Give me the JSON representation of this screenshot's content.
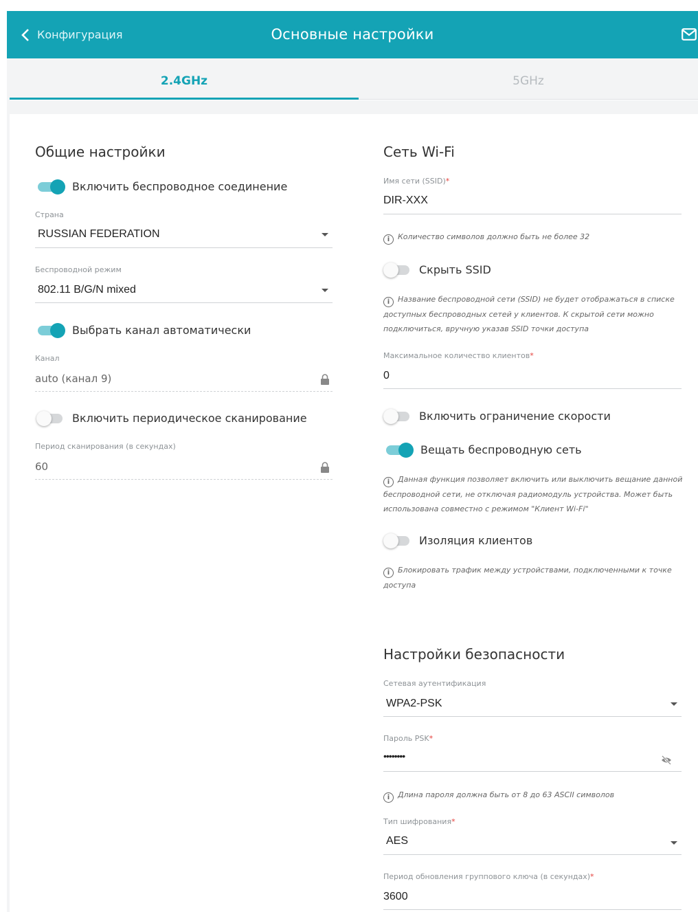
{
  "header": {
    "back_label": "Конфигурация",
    "title": "Основные настройки"
  },
  "tabs": [
    {
      "label": "2.4GHz",
      "active": true
    },
    {
      "label": "5GHz",
      "active": false
    }
  ],
  "general": {
    "title": "Общие настройки",
    "enable_wireless": {
      "label": "Включить беспроводное соединение",
      "on": true
    },
    "country": {
      "label": "Страна",
      "value": "RUSSIAN FEDERATION"
    },
    "mode": {
      "label": "Беспроводной режим",
      "value": "802.11 B/G/N mixed"
    },
    "auto_channel": {
      "label": "Выбрать канал автоматически",
      "on": true
    },
    "channel": {
      "label": "Канал",
      "value": "auto (канал 9)"
    },
    "periodic_scan": {
      "label": "Включить периодическое сканирование",
      "on": false
    },
    "scan_period": {
      "label": "Период сканирования (в секундах)",
      "value": "60"
    }
  },
  "wifi": {
    "title": "Сеть Wi-Fi",
    "ssid": {
      "label": "Имя сети (SSID)",
      "required": "*",
      "value": "DIR-XXX"
    },
    "ssid_hint": "Количество символов должно быть не более 32",
    "hide_ssid": {
      "label": "Скрыть SSID",
      "on": false
    },
    "hide_ssid_hint": "Название беспроводной сети (SSID) не будет отображаться в списке доступных беспроводных сетей у клиентов. К скрытой сети можно подключиться, вручную указав SSID точки доступа",
    "max_clients": {
      "label": "Максимальное количество клиентов",
      "required": "*",
      "value": "0"
    },
    "rate_limit": {
      "label": "Включить ограничение скорости",
      "on": false
    },
    "broadcast": {
      "label": "Вещать беспроводную сеть",
      "on": true
    },
    "broadcast_hint": "Данная функция позволяет включить или выключить вещание данной беспроводной сети, не отключая радиомодуль устройства. Может быть использована совместно с режимом \"Клиент Wi-Fi\"",
    "isolation": {
      "label": "Изоляция клиентов",
      "on": false
    },
    "isolation_hint": "Блокировать трафик между устройствами, подключенными к точке доступа"
  },
  "security": {
    "title": "Настройки безопасности",
    "auth": {
      "label": "Сетевая аутентификация",
      "value": "WPA2-PSK"
    },
    "psk": {
      "label": "Пароль PSK",
      "required": "*",
      "value": "••••••••"
    },
    "psk_hint": "Длина пароля должна быть от 8 до 63 ASCII символов",
    "encryption": {
      "label": "Тип шифрования",
      "required": "*",
      "value": "AES"
    },
    "group_key": {
      "label": "Период обновления группового ключа (в секундах)",
      "required": "*",
      "value": "3600"
    }
  },
  "colors": {
    "accent": "#14a3b5",
    "required": "#e5403c"
  },
  "icons": [
    "chevron-left-icon",
    "mail-icon",
    "lock-icon",
    "eye-off-icon",
    "info-icon",
    "caret-down-icon"
  ]
}
